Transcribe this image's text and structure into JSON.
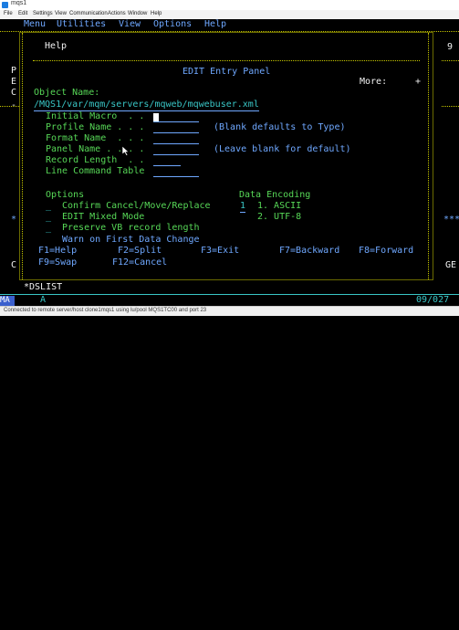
{
  "window": {
    "title": "mqs1",
    "menu": [
      "File",
      "Edit",
      "Settings",
      "View",
      "Communication",
      "Actions",
      "Window",
      "Help"
    ],
    "status": "Connected to remote server/host clone1mqs1 using lu/pool MQS1TC00 and port 23"
  },
  "ispf": {
    "menu": [
      "Menu",
      "Utilities",
      "View",
      "Options",
      "Help"
    ],
    "left_letters": [
      "P",
      "E",
      "C",
      "-",
      "*",
      "C"
    ],
    "right_letters": [
      "9",
      "*",
      "*",
      "*",
      "GE"
    ],
    "right_stars": "***"
  },
  "panel": {
    "help_label": "Help",
    "title": "EDIT Entry Panel",
    "more_label": "More:",
    "more_value": "+",
    "object_name_label": "Object Name:",
    "object_name_value": "/MQS1/var/mqm/servers/mqweb/mqwebuser.xml",
    "fields": [
      {
        "label": "Initial Macro  . .",
        "hint": ""
      },
      {
        "label": "Profile Name . . .",
        "hint": "(Blank defaults to Type)"
      },
      {
        "label": "Format Name  . . .",
        "hint": ""
      },
      {
        "label": "Panel Name . . . .",
        "hint": "(Leave blank for default)"
      },
      {
        "label": "Record Length  . .",
        "hint": ""
      },
      {
        "label": "Line Command Table",
        "hint": ""
      }
    ],
    "options_label": "Options",
    "options": [
      "Confirm Cancel/Move/Replace",
      "EDIT Mixed Mode",
      "Preserve VB record length"
    ],
    "warn_text": "Warn on First Data Change",
    "data_encoding_label": "Data Encoding",
    "encoding_selected": "1",
    "encodings": [
      "1. ASCII",
      "2. UTF-8"
    ],
    "fkeys": [
      "F1=Help",
      "F2=Split",
      "F3=Exit",
      "F7=Backward",
      "F8=Forward",
      "F9=Swap",
      "F12=Cancel"
    ]
  },
  "bottom": {
    "command_text": "*DSLIST",
    "oia_left": "MA",
    "oia_mode": "A",
    "cursor_pos": "09/027"
  }
}
